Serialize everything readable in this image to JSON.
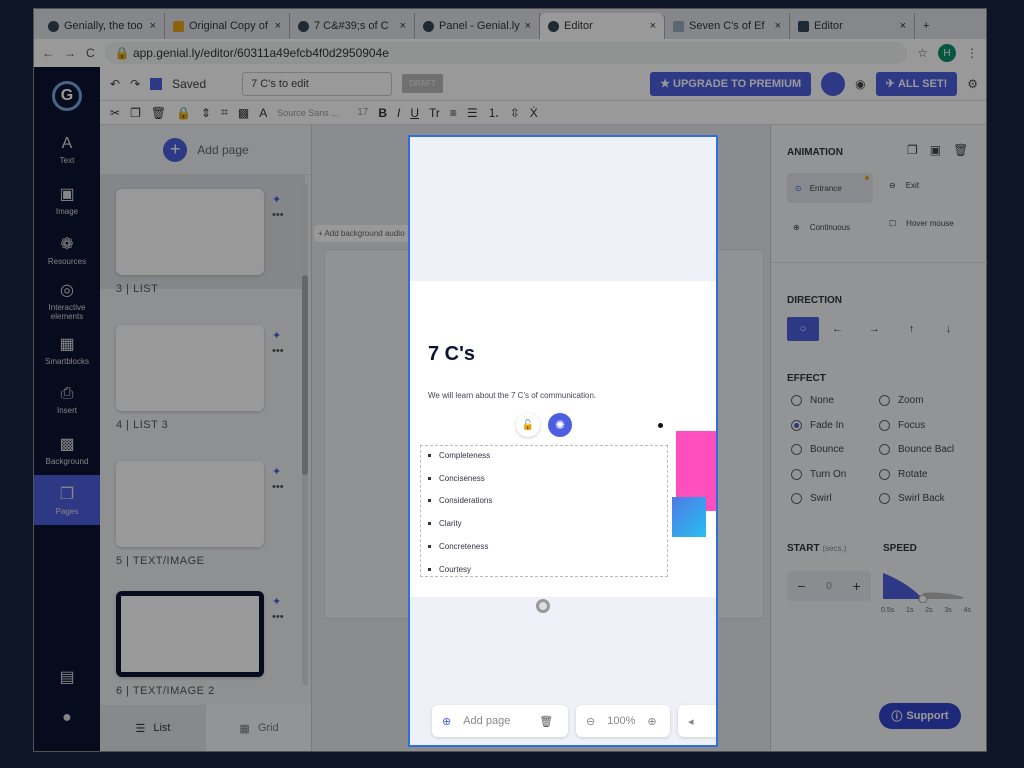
{
  "browser": {
    "tabs": [
      "Genially, the too",
      "Original Copy of",
      "7 C&#39;s of C",
      "Panel - Genial.ly",
      "Editor",
      "Seven C's of Ef",
      "Editor"
    ],
    "active_tab": 4,
    "url": "app.genial.ly/editor/60311a49efcb4f0d2950904e",
    "profile": "H"
  },
  "topbar": {
    "saved": "Saved",
    "title": "7 C's to edit",
    "draft": "DRAFT",
    "upgrade": "UPGRADE TO PREMIUM",
    "all_set": "ALL SET!"
  },
  "toolbar": {
    "font": "Source Sans ...",
    "size": "17"
  },
  "iconbar": [
    {
      "label": "Text",
      "icon": "A"
    },
    {
      "label": "Image",
      "icon": "▣"
    },
    {
      "label": "Resources",
      "icon": "❁"
    },
    {
      "label": "Interactive elements",
      "icon": "◎"
    },
    {
      "label": "Smartblocks",
      "icon": "▦"
    },
    {
      "label": "Insert",
      "icon": "⎙"
    },
    {
      "label": "Background",
      "icon": "▩"
    },
    {
      "label": "Pages",
      "icon": "❐"
    }
  ],
  "pages": {
    "add": "Add page",
    "items": [
      "3 | LIST",
      "4 | LIST 3",
      "5 | TEXT/IMAGE",
      "6 | TEXT/IMAGE 2"
    ],
    "list": "List",
    "grid": "Grid"
  },
  "canvas": {
    "bg_audio": "Add background audio"
  },
  "slide": {
    "title": "7 C's",
    "subtitle": "We will learn about the 7 C's of communication.",
    "items": [
      "Completeness",
      "Conciseness",
      "Considerations",
      "Clarity",
      "Concreteness",
      "Courtesy"
    ]
  },
  "bottom": {
    "add_page": "Add page",
    "zoom": "100%"
  },
  "animation": {
    "header": "ANIMATION",
    "types": [
      "Entrance",
      "Exit",
      "Continuous",
      "Hover mouse"
    ],
    "direction": "DIRECTION",
    "effect": "EFFECT",
    "effects": [
      "None",
      "Zoom",
      "Fade In",
      "Focus",
      "Bounce",
      "Bounce Bacl",
      "Turn On",
      "Rotate",
      "Swirl",
      "Swirl Back"
    ],
    "selected_effect": "Fade In",
    "start": "START",
    "start_unit": "(secs.)",
    "start_value": "0",
    "speed": "SPEED",
    "speed_ticks": [
      "0.5s",
      "1s",
      "2s",
      "3s",
      "4s"
    ],
    "speed_value": "2s",
    "support": "Support"
  }
}
